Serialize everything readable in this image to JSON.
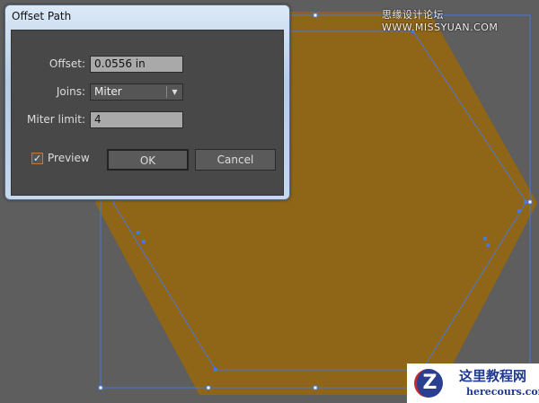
{
  "watermark": "思缘设计论坛 WWW.MISSYUAN.COM",
  "dialog": {
    "title": "Offset Path",
    "offset_label": "Offset:",
    "offset_value": "0.0556 in",
    "joins_label": "Joins:",
    "joins_value": "Miter",
    "miter_label": "Miter limit:",
    "miter_value": "4",
    "preview_label": "Preview",
    "preview_checked": true,
    "ok": "OK",
    "cancel": "Cancel"
  },
  "logo": {
    "cn": "这里教程网",
    "en": "herecours.com"
  },
  "colors": {
    "fill": "#8f6517",
    "path": "#4a78d6",
    "canvas": "#5e5e5e"
  }
}
